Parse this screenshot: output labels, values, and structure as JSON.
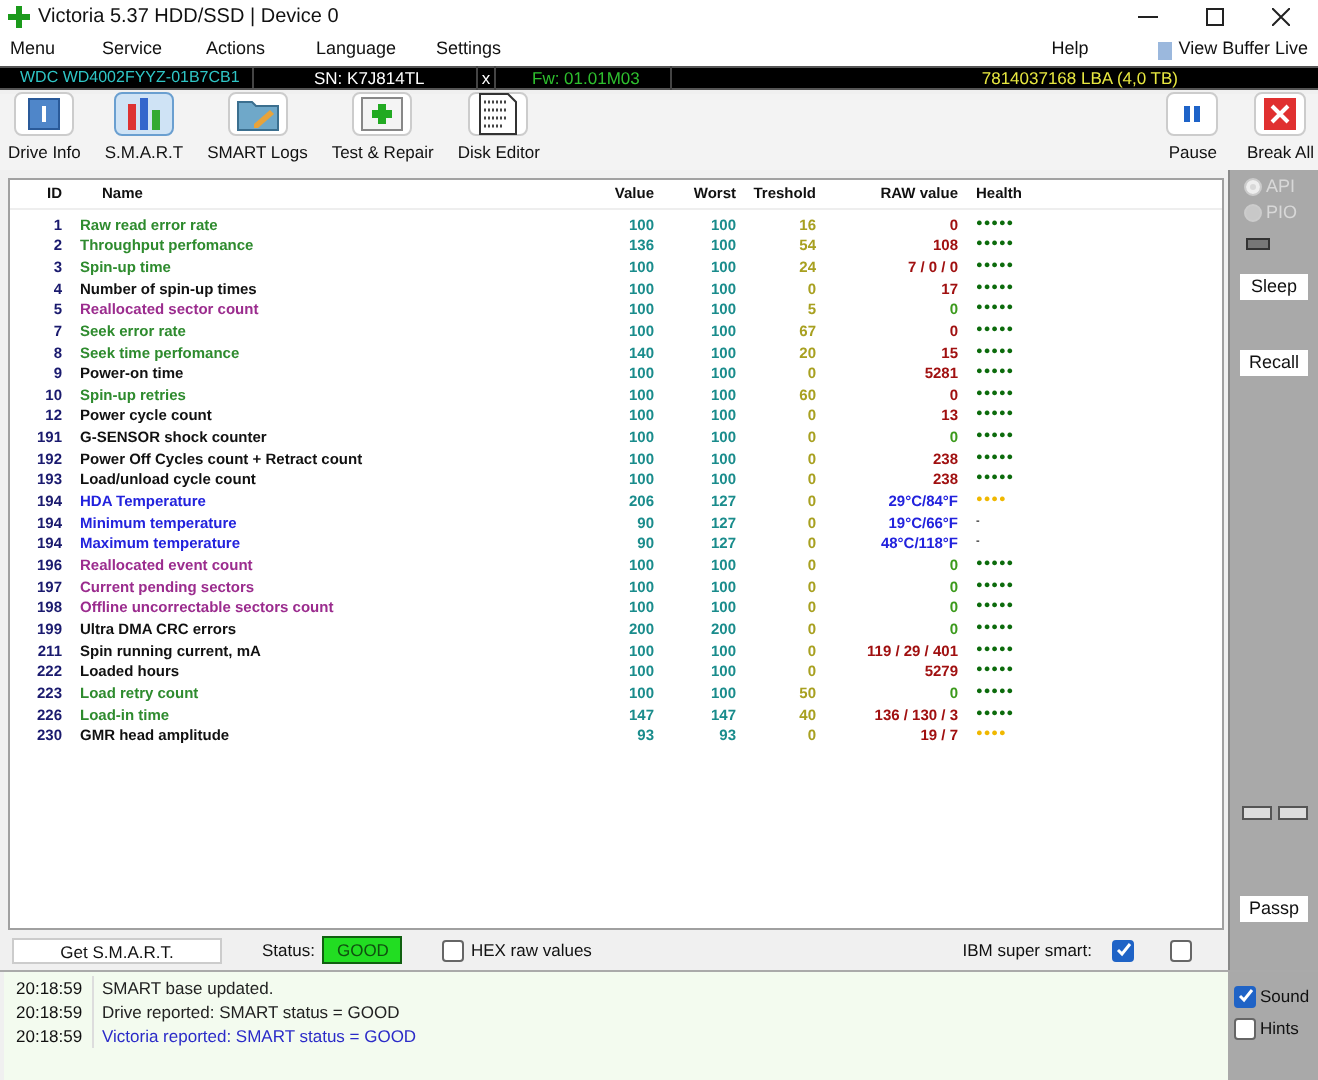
{
  "window": {
    "title": "Victoria 5.37 HDD/SSD | Device 0"
  },
  "menu": [
    {
      "label": "Menu"
    },
    {
      "label": "Service"
    },
    {
      "label": "Actions"
    },
    {
      "label": "Language"
    },
    {
      "label": "Settings"
    }
  ],
  "menu_right": {
    "help": "Help",
    "buffer": "View Buffer Live"
  },
  "drive_bar": {
    "model": "WDC WD4002FYYZ-01B7CB1",
    "serial": "SN: K7J814TL",
    "close": "x",
    "firmware": "Fw: 01.01M03",
    "capacity": "7814037168 LBA (4,0 TB)"
  },
  "toolbar": [
    {
      "label": "Drive Info",
      "kind": "info",
      "selected": false
    },
    {
      "label": "S.M.A.R.T",
      "kind": "smart",
      "selected": true
    },
    {
      "label": "SMART Logs",
      "kind": "logs",
      "selected": false
    },
    {
      "label": "Test & Repair",
      "kind": "test",
      "selected": false
    },
    {
      "label": "Disk Editor",
      "kind": "editor",
      "selected": false
    }
  ],
  "toolbar_right": [
    {
      "label": "Pause",
      "kind": "pause"
    },
    {
      "label": "Break All",
      "kind": "break"
    }
  ],
  "table": {
    "columns": [
      "ID",
      "Name",
      "Value",
      "Worst",
      "Treshold",
      "RAW value",
      "Health"
    ],
    "rows": [
      {
        "id": "1",
        "name": "Raw read error rate",
        "kind": "green",
        "value": "100",
        "worst": "100",
        "threshold": "16",
        "raw": {
          "text": "0",
          "kind": "red"
        },
        "health": {
          "text": "●●●●●",
          "kind": "good"
        }
      },
      {
        "id": "2",
        "name": "Throughput perfomance",
        "kind": "green",
        "value": "136",
        "worst": "100",
        "threshold": "54",
        "raw": {
          "text": "108",
          "kind": "red"
        },
        "health": {
          "text": "●●●●●",
          "kind": "good"
        }
      },
      {
        "id": "3",
        "name": "Spin-up time",
        "kind": "green",
        "value": "100",
        "worst": "100",
        "threshold": "24",
        "raw": {
          "text": "7 / 0 / 0",
          "kind": "red"
        },
        "health": {
          "text": "●●●●●",
          "kind": "good"
        }
      },
      {
        "id": "4",
        "name": "Number of spin-up times",
        "kind": "black",
        "value": "100",
        "worst": "100",
        "threshold": "0",
        "raw": {
          "text": "17",
          "kind": "red"
        },
        "health": {
          "text": "●●●●●",
          "kind": "good"
        }
      },
      {
        "id": "5",
        "name": "Reallocated sector count",
        "kind": "purple",
        "value": "100",
        "worst": "100",
        "threshold": "5",
        "raw": {
          "text": "0",
          "kind": "green"
        },
        "health": {
          "text": "●●●●●",
          "kind": "good"
        }
      },
      {
        "id": "7",
        "name": "Seek error rate",
        "kind": "green",
        "value": "100",
        "worst": "100",
        "threshold": "67",
        "raw": {
          "text": "0",
          "kind": "red"
        },
        "health": {
          "text": "●●●●●",
          "kind": "good"
        }
      },
      {
        "id": "8",
        "name": "Seek time perfomance",
        "kind": "green",
        "value": "140",
        "worst": "100",
        "threshold": "20",
        "raw": {
          "text": "15",
          "kind": "red"
        },
        "health": {
          "text": "●●●●●",
          "kind": "good"
        }
      },
      {
        "id": "9",
        "name": "Power-on time",
        "kind": "black",
        "value": "100",
        "worst": "100",
        "threshold": "0",
        "raw": {
          "text": "5281",
          "kind": "red"
        },
        "health": {
          "text": "●●●●●",
          "kind": "good"
        }
      },
      {
        "id": "10",
        "name": "Spin-up retries",
        "kind": "green",
        "value": "100",
        "worst": "100",
        "threshold": "60",
        "raw": {
          "text": "0",
          "kind": "red"
        },
        "health": {
          "text": "●●●●●",
          "kind": "good"
        }
      },
      {
        "id": "12",
        "name": "Power cycle count",
        "kind": "black",
        "value": "100",
        "worst": "100",
        "threshold": "0",
        "raw": {
          "text": "13",
          "kind": "red"
        },
        "health": {
          "text": "●●●●●",
          "kind": "good"
        }
      },
      {
        "id": "191",
        "name": "G-SENSOR shock counter",
        "kind": "black",
        "value": "100",
        "worst": "100",
        "threshold": "0",
        "raw": {
          "text": "0",
          "kind": "green"
        },
        "health": {
          "text": "●●●●●",
          "kind": "good"
        }
      },
      {
        "id": "192",
        "name": "Power Off Cycles count + Retract count",
        "kind": "black",
        "value": "100",
        "worst": "100",
        "threshold": "0",
        "raw": {
          "text": "238",
          "kind": "red"
        },
        "health": {
          "text": "●●●●●",
          "kind": "good"
        }
      },
      {
        "id": "193",
        "name": "Load/unload cycle count",
        "kind": "black",
        "value": "100",
        "worst": "100",
        "threshold": "0",
        "raw": {
          "text": "238",
          "kind": "red"
        },
        "health": {
          "text": "●●●●●",
          "kind": "good"
        }
      },
      {
        "id": "194",
        "name": "HDA Temperature",
        "kind": "blue",
        "value": "206",
        "worst": "127",
        "threshold": "0",
        "raw": {
          "text": "29°C/84°F",
          "kind": "blue"
        },
        "health": {
          "text": "●●●●",
          "kind": "warn"
        }
      },
      {
        "id": "194",
        "name": "Minimum temperature",
        "kind": "blue",
        "value": "90",
        "worst": "127",
        "threshold": "0",
        "raw": {
          "text": "19°C/66°F",
          "kind": "blue"
        },
        "health": {
          "text": "-",
          "kind": "none"
        }
      },
      {
        "id": "194",
        "name": "Maximum temperature",
        "kind": "blue",
        "value": "90",
        "worst": "127",
        "threshold": "0",
        "raw": {
          "text": "48°C/118°F",
          "kind": "blue"
        },
        "health": {
          "text": "-",
          "kind": "none"
        }
      },
      {
        "id": "196",
        "name": "Reallocated event count",
        "kind": "purple",
        "value": "100",
        "worst": "100",
        "threshold": "0",
        "raw": {
          "text": "0",
          "kind": "green"
        },
        "health": {
          "text": "●●●●●",
          "kind": "good"
        }
      },
      {
        "id": "197",
        "name": "Current pending sectors",
        "kind": "purple",
        "value": "100",
        "worst": "100",
        "threshold": "0",
        "raw": {
          "text": "0",
          "kind": "green"
        },
        "health": {
          "text": "●●●●●",
          "kind": "good"
        }
      },
      {
        "id": "198",
        "name": "Offline uncorrectable sectors count",
        "kind": "purple",
        "value": "100",
        "worst": "100",
        "threshold": "0",
        "raw": {
          "text": "0",
          "kind": "green"
        },
        "health": {
          "text": "●●●●●",
          "kind": "good"
        }
      },
      {
        "id": "199",
        "name": "Ultra DMA CRC errors",
        "kind": "black",
        "value": "200",
        "worst": "200",
        "threshold": "0",
        "raw": {
          "text": "0",
          "kind": "green"
        },
        "health": {
          "text": "●●●●●",
          "kind": "good"
        }
      },
      {
        "id": "211",
        "name": "Spin running current, mA",
        "kind": "black",
        "value": "100",
        "worst": "100",
        "threshold": "0",
        "raw": {
          "text": "119 / 29 / 401",
          "kind": "red"
        },
        "health": {
          "text": "●●●●●",
          "kind": "good"
        }
      },
      {
        "id": "222",
        "name": "Loaded hours",
        "kind": "black",
        "value": "100",
        "worst": "100",
        "threshold": "0",
        "raw": {
          "text": "5279",
          "kind": "red"
        },
        "health": {
          "text": "●●●●●",
          "kind": "good"
        }
      },
      {
        "id": "223",
        "name": "Load retry count",
        "kind": "green",
        "value": "100",
        "worst": "100",
        "threshold": "50",
        "raw": {
          "text": "0",
          "kind": "green"
        },
        "health": {
          "text": "●●●●●",
          "kind": "good"
        }
      },
      {
        "id": "226",
        "name": "Load-in time",
        "kind": "green",
        "value": "147",
        "worst": "147",
        "threshold": "40",
        "raw": {
          "text": "136 / 130 / 3",
          "kind": "red"
        },
        "health": {
          "text": "●●●●●",
          "kind": "good"
        }
      },
      {
        "id": "230",
        "name": "GMR head amplitude",
        "kind": "black",
        "value": "93",
        "worst": "93",
        "threshold": "0",
        "raw": {
          "text": "19 / 7",
          "kind": "red"
        },
        "health": {
          "text": "●●●●",
          "kind": "warn"
        }
      }
    ]
  },
  "side": {
    "radios": [
      {
        "label": "API",
        "selected": true
      },
      {
        "label": "PIO",
        "selected": false
      }
    ],
    "sleep": "Sleep",
    "recall": "Recall",
    "passp": "Passp"
  },
  "status_row": {
    "get": "Get S.M.A.R.T.",
    "status_label": "Status:",
    "status": "GOOD",
    "hex": {
      "label": "HEX raw values",
      "checked": false
    },
    "ibm": {
      "label": "IBM super smart:",
      "checked": true
    },
    "extra_checked": false
  },
  "log": [
    {
      "time": "20:18:59",
      "text": "SMART base updated.",
      "kind": "normal"
    },
    {
      "time": "20:18:59",
      "text": "Drive reported: SMART status = GOOD",
      "kind": "normal"
    },
    {
      "time": "20:18:59",
      "text": "Victoria reported: SMART status = GOOD",
      "kind": "victoria"
    }
  ],
  "log_side": [
    {
      "label": "Sound",
      "checked": true
    },
    {
      "label": "Hints",
      "checked": false
    }
  ]
}
